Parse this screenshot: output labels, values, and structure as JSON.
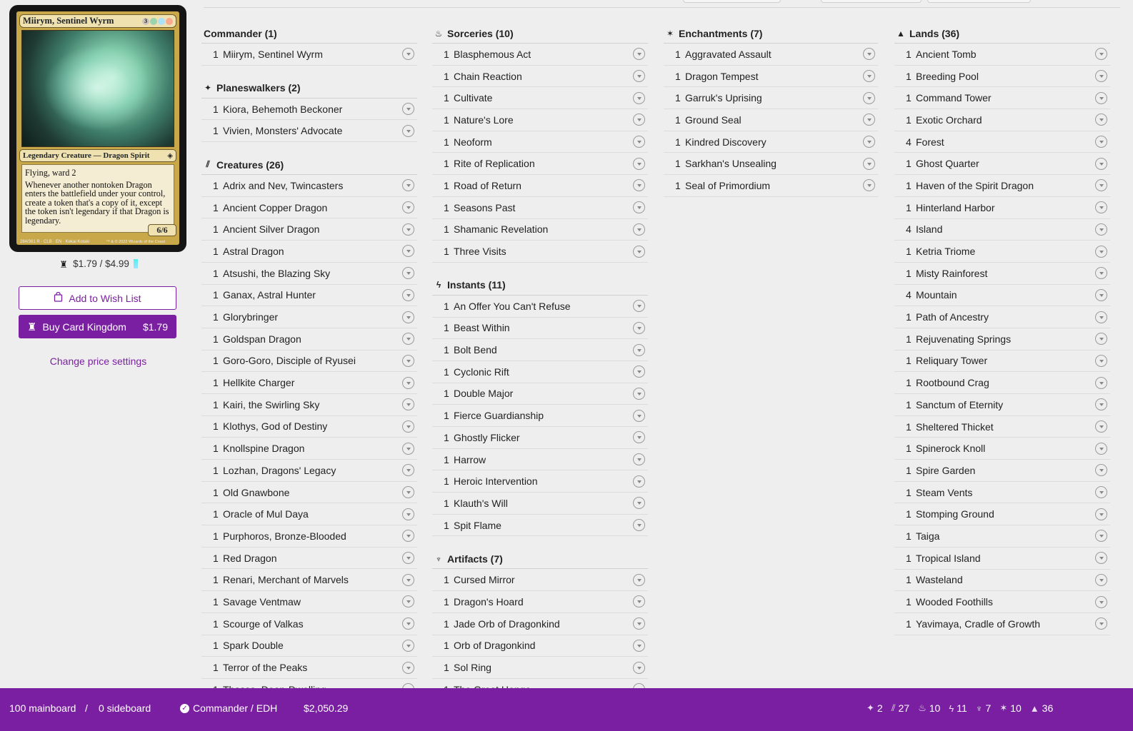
{
  "card": {
    "name": "Miirym, Sentinel Wyrm",
    "mana_cost": "3",
    "type_line": "Legendary Creature — Dragon Spirit",
    "text_1": "Flying, ward 2",
    "text_2": "Whenever another nontoken Dragon enters the battlefield under your control, create a token that's a copy of it, except the token isn't legendary if that Dragon is legendary.",
    "pt": "6/6",
    "footer": "284/361 R · CLB · EN · Kekai Kotaki",
    "copyright": "™ & © 2022 Wizards of the Coast"
  },
  "price": {
    "text": "$1.79 / $4.99"
  },
  "wish_button": {
    "label": "Add to Wish List"
  },
  "buy_button": {
    "label": "Buy Card Kingdom",
    "price": "$1.79"
  },
  "change_price": {
    "label": "Change price settings"
  },
  "columns": [
    {
      "sections": [
        {
          "title": "Commander (1)",
          "icon": "",
          "cards": [
            {
              "qty": "1",
              "name": "Miirym, Sentinel Wyrm"
            }
          ]
        },
        {
          "title": "Planeswalkers (2)",
          "icon": "planeswalker-icon",
          "cards": [
            {
              "qty": "1",
              "name": "Kiora, Behemoth Beckoner"
            },
            {
              "qty": "1",
              "name": "Vivien, Monsters' Advocate"
            }
          ]
        },
        {
          "title": "Creatures (26)",
          "icon": "creature-icon",
          "cards": [
            {
              "qty": "1",
              "name": "Adrix and Nev, Twincasters"
            },
            {
              "qty": "1",
              "name": "Ancient Copper Dragon"
            },
            {
              "qty": "1",
              "name": "Ancient Silver Dragon"
            },
            {
              "qty": "1",
              "name": "Astral Dragon"
            },
            {
              "qty": "1",
              "name": "Atsushi, the Blazing Sky"
            },
            {
              "qty": "1",
              "name": "Ganax, Astral Hunter"
            },
            {
              "qty": "1",
              "name": "Glorybringer"
            },
            {
              "qty": "1",
              "name": "Goldspan Dragon"
            },
            {
              "qty": "1",
              "name": "Goro-Goro, Disciple of Ryusei"
            },
            {
              "qty": "1",
              "name": "Hellkite Charger"
            },
            {
              "qty": "1",
              "name": "Kairi, the Swirling Sky"
            },
            {
              "qty": "1",
              "name": "Klothys, God of Destiny"
            },
            {
              "qty": "1",
              "name": "Knollspine Dragon"
            },
            {
              "qty": "1",
              "name": "Lozhan, Dragons' Legacy"
            },
            {
              "qty": "1",
              "name": "Old Gnawbone"
            },
            {
              "qty": "1",
              "name": "Oracle of Mul Daya"
            },
            {
              "qty": "1",
              "name": "Purphoros, Bronze-Blooded"
            },
            {
              "qty": "1",
              "name": "Red Dragon"
            },
            {
              "qty": "1",
              "name": "Renari, Merchant of Marvels"
            },
            {
              "qty": "1",
              "name": "Savage Ventmaw"
            },
            {
              "qty": "1",
              "name": "Scourge of Valkas"
            },
            {
              "qty": "1",
              "name": "Spark Double"
            },
            {
              "qty": "1",
              "name": "Terror of the Peaks"
            },
            {
              "qty": "1",
              "name": "Thassa, Deep-Dwelling"
            }
          ]
        }
      ]
    },
    {
      "sections": [
        {
          "title": "Sorceries (10)",
          "icon": "sorcery-icon",
          "cards": [
            {
              "qty": "1",
              "name": "Blasphemous Act"
            },
            {
              "qty": "1",
              "name": "Chain Reaction"
            },
            {
              "qty": "1",
              "name": "Cultivate"
            },
            {
              "qty": "1",
              "name": "Nature's Lore"
            },
            {
              "qty": "1",
              "name": "Neoform"
            },
            {
              "qty": "1",
              "name": "Rite of Replication"
            },
            {
              "qty": "1",
              "name": "Road of Return"
            },
            {
              "qty": "1",
              "name": "Seasons Past"
            },
            {
              "qty": "1",
              "name": "Shamanic Revelation"
            },
            {
              "qty": "1",
              "name": "Three Visits"
            }
          ]
        },
        {
          "title": "Instants (11)",
          "icon": "instant-icon",
          "cards": [
            {
              "qty": "1",
              "name": "An Offer You Can't Refuse"
            },
            {
              "qty": "1",
              "name": "Beast Within"
            },
            {
              "qty": "1",
              "name": "Bolt Bend"
            },
            {
              "qty": "1",
              "name": "Cyclonic Rift"
            },
            {
              "qty": "1",
              "name": "Double Major"
            },
            {
              "qty": "1",
              "name": "Fierce Guardianship"
            },
            {
              "qty": "1",
              "name": "Ghostly Flicker"
            },
            {
              "qty": "1",
              "name": "Harrow"
            },
            {
              "qty": "1",
              "name": "Heroic Intervention"
            },
            {
              "qty": "1",
              "name": "Klauth's Will"
            },
            {
              "qty": "1",
              "name": "Spit Flame"
            }
          ]
        },
        {
          "title": "Artifacts (7)",
          "icon": "artifact-icon",
          "cards": [
            {
              "qty": "1",
              "name": "Cursed Mirror"
            },
            {
              "qty": "1",
              "name": "Dragon's Hoard"
            },
            {
              "qty": "1",
              "name": "Jade Orb of Dragonkind"
            },
            {
              "qty": "1",
              "name": "Orb of Dragonkind"
            },
            {
              "qty": "1",
              "name": "Sol Ring"
            },
            {
              "qty": "1",
              "name": "The Great Henge"
            }
          ]
        }
      ]
    },
    {
      "sections": [
        {
          "title": "Enchantments (7)",
          "icon": "enchantment-icon",
          "cards": [
            {
              "qty": "1",
              "name": "Aggravated Assault"
            },
            {
              "qty": "1",
              "name": "Dragon Tempest"
            },
            {
              "qty": "1",
              "name": "Garruk's Uprising"
            },
            {
              "qty": "1",
              "name": "Ground Seal"
            },
            {
              "qty": "1",
              "name": "Kindred Discovery"
            },
            {
              "qty": "1",
              "name": "Sarkhan's Unsealing"
            },
            {
              "qty": "1",
              "name": "Seal of Primordium"
            }
          ]
        }
      ]
    },
    {
      "sections": [
        {
          "title": "Lands (36)",
          "icon": "land-icon",
          "cards": [
            {
              "qty": "1",
              "name": "Ancient Tomb"
            },
            {
              "qty": "1",
              "name": "Breeding Pool"
            },
            {
              "qty": "1",
              "name": "Command Tower"
            },
            {
              "qty": "1",
              "name": "Exotic Orchard"
            },
            {
              "qty": "4",
              "name": "Forest"
            },
            {
              "qty": "1",
              "name": "Ghost Quarter"
            },
            {
              "qty": "1",
              "name": "Haven of the Spirit Dragon"
            },
            {
              "qty": "1",
              "name": "Hinterland Harbor"
            },
            {
              "qty": "4",
              "name": "Island"
            },
            {
              "qty": "1",
              "name": "Ketria Triome"
            },
            {
              "qty": "1",
              "name": "Misty Rainforest"
            },
            {
              "qty": "4",
              "name": "Mountain"
            },
            {
              "qty": "1",
              "name": "Path of Ancestry"
            },
            {
              "qty": "1",
              "name": "Rejuvenating Springs"
            },
            {
              "qty": "1",
              "name": "Reliquary Tower"
            },
            {
              "qty": "1",
              "name": "Rootbound Crag"
            },
            {
              "qty": "1",
              "name": "Sanctum of Eternity"
            },
            {
              "qty": "1",
              "name": "Sheltered Thicket"
            },
            {
              "qty": "1",
              "name": "Spinerock Knoll"
            },
            {
              "qty": "1",
              "name": "Spire Garden"
            },
            {
              "qty": "1",
              "name": "Steam Vents"
            },
            {
              "qty": "1",
              "name": "Stomping Ground"
            },
            {
              "qty": "1",
              "name": "Taiga"
            },
            {
              "qty": "1",
              "name": "Tropical Island"
            },
            {
              "qty": "1",
              "name": "Wasteland"
            },
            {
              "qty": "1",
              "name": "Wooded Foothills"
            },
            {
              "qty": "1",
              "name": "Yavimaya, Cradle of Growth"
            }
          ]
        }
      ]
    }
  ],
  "bottom_bar": {
    "mainboard": "100 mainboard",
    "separator": "/",
    "sideboard": "0 sideboard",
    "format": "Commander / EDH",
    "total_price": "$2,050.29",
    "counts": [
      {
        "icon": "planeswalker-icon",
        "value": "2"
      },
      {
        "icon": "creature-icon",
        "value": "27"
      },
      {
        "icon": "sorcery-icon",
        "value": "10"
      },
      {
        "icon": "instant-icon",
        "value": "11"
      },
      {
        "icon": "artifact-icon",
        "value": "7"
      },
      {
        "icon": "enchantment-icon",
        "value": "10"
      },
      {
        "icon": "land-icon",
        "value": "36"
      }
    ]
  },
  "colors": {
    "accent": "#7b1fa2",
    "background": "#eeeeee"
  }
}
